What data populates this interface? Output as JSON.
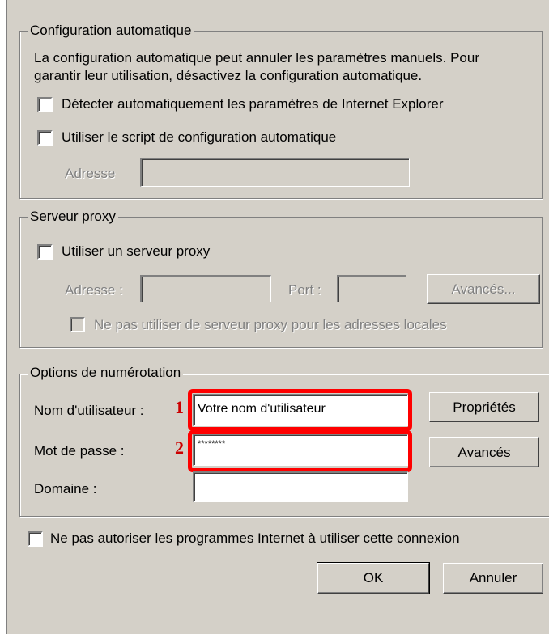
{
  "auto_config": {
    "legend": "Configuration automatique",
    "description_line1": "La configuration automatique peut annuler les paramètres manuels. Pour",
    "description_line2": "garantir leur utilisation, désactivez la configuration automatique.",
    "detect_checkbox_label": "Détecter automatiquement les paramètres de Internet Explorer",
    "script_checkbox_label": "Utiliser le script de configuration automatique",
    "address_label": "Adresse",
    "address_value": ""
  },
  "proxy": {
    "legend": "Serveur proxy",
    "use_proxy_label": "Utiliser un serveur proxy",
    "address_label": "Adresse :",
    "address_value": "",
    "port_label": "Port :",
    "port_value": "",
    "advanced_button": "Avancés...",
    "bypass_local_label": "Ne pas utiliser de serveur proxy pour les adresses locales"
  },
  "dialing": {
    "legend": "Options de numérotation",
    "username_label": "Nom d'utilisateur :",
    "username_value": "Votre nom d'utilisateur",
    "password_label": "Mot de passe :",
    "password_value": "********",
    "domain_label": "Domaine :",
    "domain_value": "",
    "properties_button": "Propriétés",
    "advanced_button": "Avancés"
  },
  "annotations": {
    "marker1": "1",
    "marker2": "2",
    "highlight_color": "#ff0000"
  },
  "footer": {
    "disallow_label": "Ne pas autoriser les programmes Internet à utiliser cette connexion",
    "ok_button": "OK",
    "cancel_button": "Annuler"
  }
}
